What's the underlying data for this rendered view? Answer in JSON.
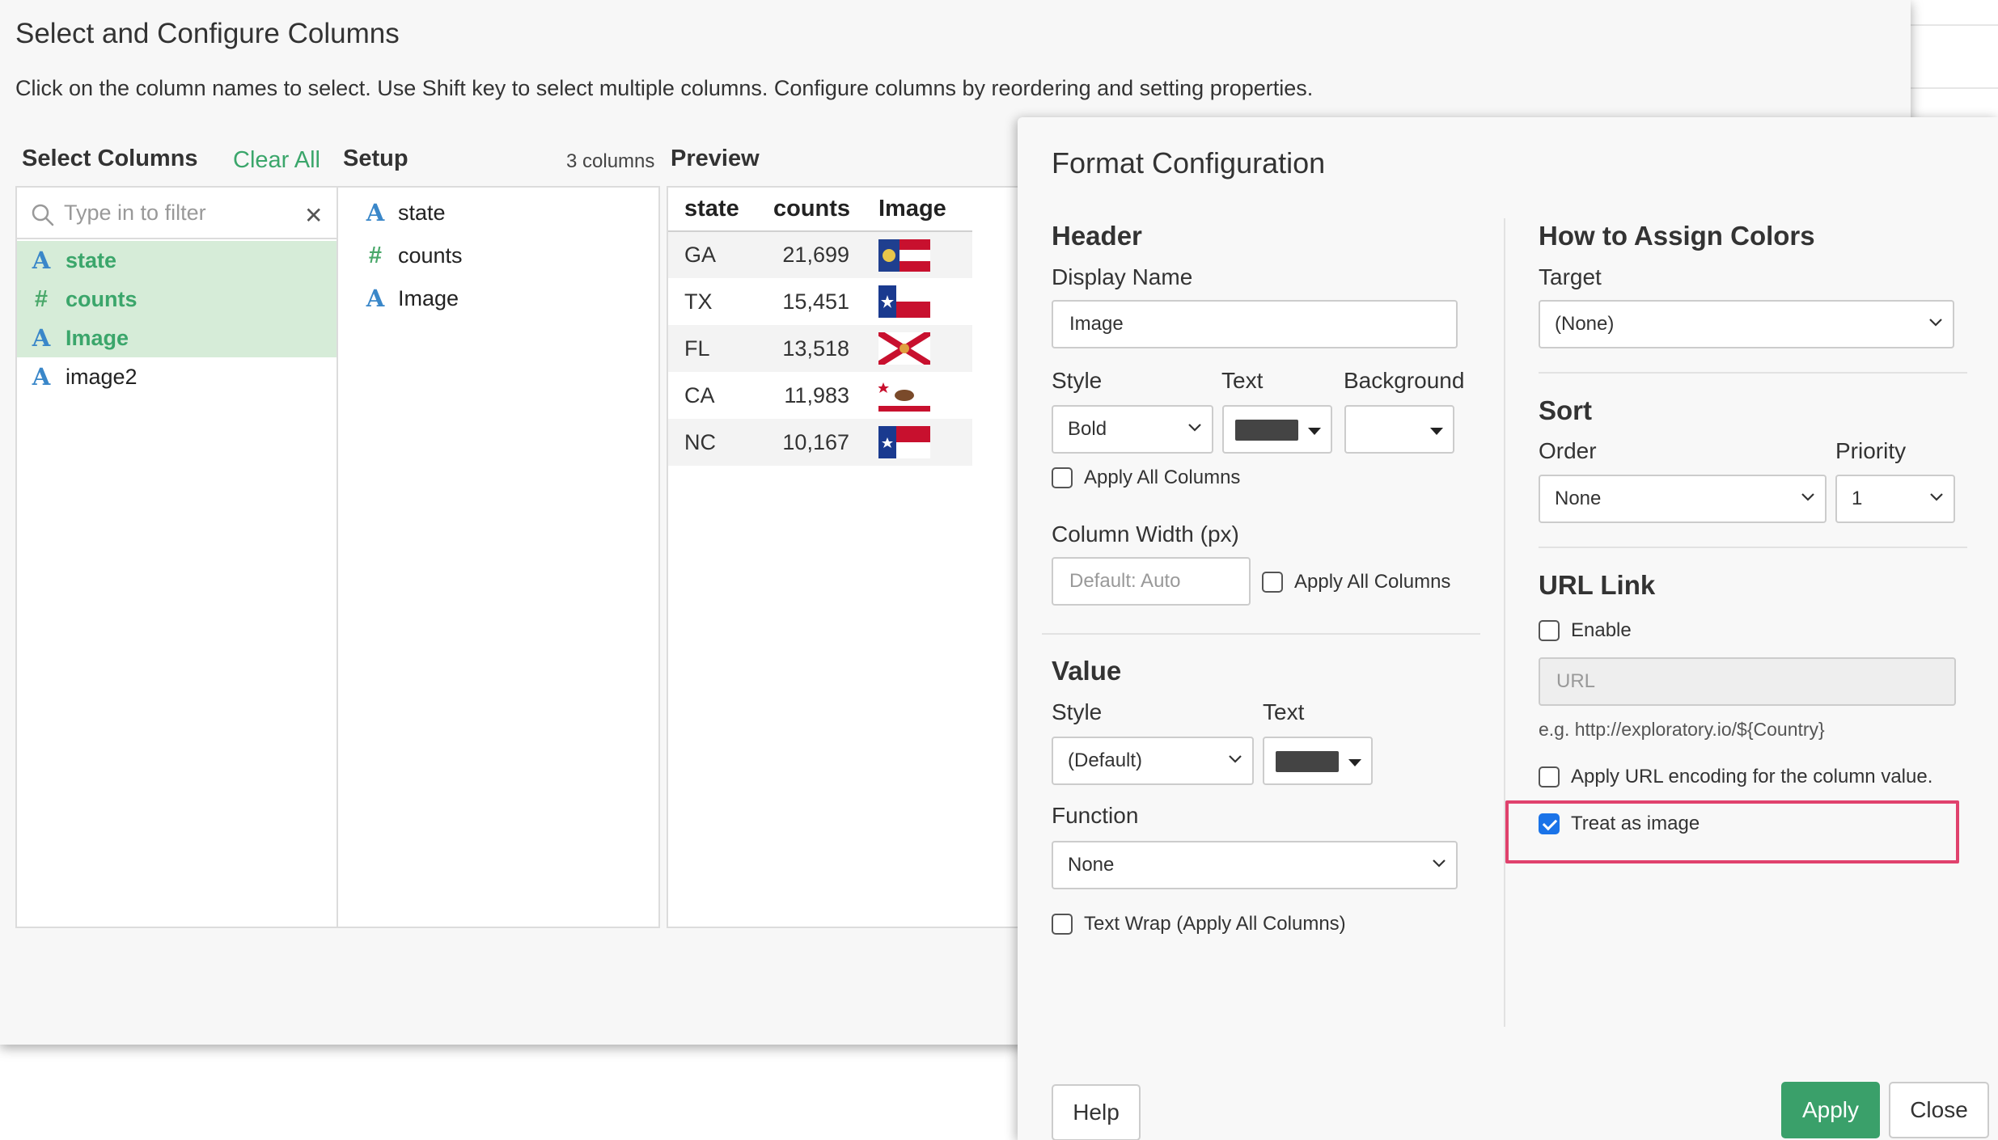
{
  "main": {
    "title": "Select and Configure Columns",
    "subtitle": "Click on the column names to select. Use Shift key to select multiple columns. Configure columns by reordering and setting properties.",
    "select_columns_label": "Select Columns",
    "clear_all_label": "Clear All",
    "setup_label": "Setup",
    "column_count": "3 columns",
    "preview_label": "Preview",
    "filter": {
      "placeholder": "Type in to filter",
      "value": ""
    },
    "columns": [
      {
        "label": "state",
        "type": "A",
        "selected": true
      },
      {
        "label": "counts",
        "type": "#",
        "selected": true
      },
      {
        "label": "Image",
        "type": "A",
        "selected": true
      },
      {
        "label": "image2",
        "type": "A",
        "selected": false
      }
    ],
    "setup_columns": [
      {
        "label": "state",
        "type": "A"
      },
      {
        "label": "counts",
        "type": "#"
      },
      {
        "label": "Image",
        "type": "A"
      }
    ],
    "preview": {
      "headers": [
        "state",
        "counts",
        "Image"
      ],
      "rows": [
        {
          "state": "GA",
          "counts": "21,699",
          "flag": "georgia-flag"
        },
        {
          "state": "TX",
          "counts": "15,451",
          "flag": "texas-flag"
        },
        {
          "state": "FL",
          "counts": "13,518",
          "flag": "florida-flag"
        },
        {
          "state": "CA",
          "counts": "11,983",
          "flag": "california-flag"
        },
        {
          "state": "NC",
          "counts": "10,167",
          "flag": "north-carolina-flag"
        }
      ]
    }
  },
  "format": {
    "title": "Format Configuration",
    "header": {
      "section_label": "Header",
      "display_name_label": "Display Name",
      "display_name_value": "Image",
      "style_label": "Style",
      "style_value": "Bold",
      "text_label": "Text",
      "text_color": "#444444",
      "background_label": "Background",
      "apply_all_label": "Apply All Columns",
      "column_width_label": "Column Width (px)",
      "column_width_placeholder": "Default: Auto",
      "width_apply_all_label": "Apply All Columns"
    },
    "value": {
      "section_label": "Value",
      "style_label": "Style",
      "style_value": "(Default)",
      "text_label": "Text",
      "text_color": "#444444",
      "function_label": "Function",
      "function_value": "None",
      "text_wrap_label": "Text Wrap (Apply All Columns)"
    },
    "colors": {
      "section_label": "How to Assign Colors",
      "target_label": "Target",
      "target_value": "(None)"
    },
    "sort": {
      "section_label": "Sort",
      "order_label": "Order",
      "order_value": "None",
      "priority_label": "Priority",
      "priority_value": "1"
    },
    "url": {
      "section_label": "URL Link",
      "enable_label": "Enable",
      "url_placeholder": "URL",
      "example": "e.g. http://exploratory.io/${Country}",
      "encoding_label": "Apply URL encoding for the column value.",
      "treat_image_label": "Treat as image",
      "treat_image_checked": true
    },
    "buttons": {
      "help": "Help",
      "apply": "Apply",
      "close": "Close"
    },
    "accent_color": "#3aa06a",
    "highlight_color": "#e0426d"
  }
}
